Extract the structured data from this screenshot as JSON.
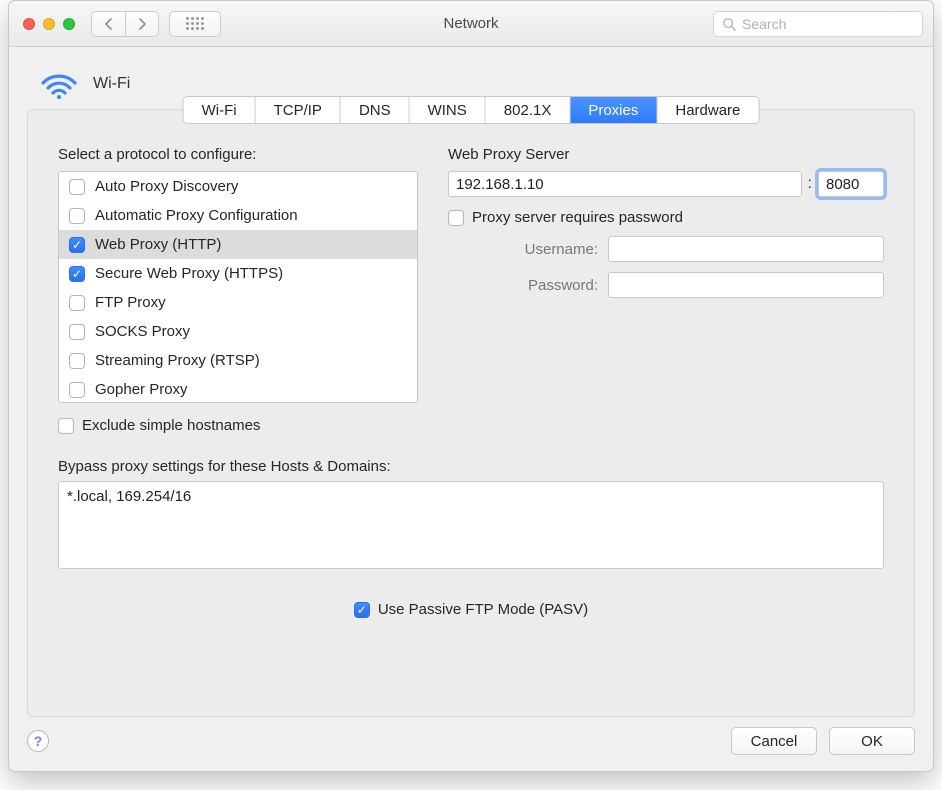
{
  "window": {
    "title": "Network"
  },
  "search": {
    "placeholder": "Search"
  },
  "header": {
    "label": "Wi-Fi"
  },
  "tabs": [
    {
      "label": "Wi-Fi",
      "active": false
    },
    {
      "label": "TCP/IP",
      "active": false
    },
    {
      "label": "DNS",
      "active": false
    },
    {
      "label": "WINS",
      "active": false
    },
    {
      "label": "802.1X",
      "active": false
    },
    {
      "label": "Proxies",
      "active": true
    },
    {
      "label": "Hardware",
      "active": false
    }
  ],
  "protocols": {
    "heading": "Select a protocol to configure:",
    "items": [
      {
        "label": "Auto Proxy Discovery",
        "checked": false,
        "selected": false
      },
      {
        "label": "Automatic Proxy Configuration",
        "checked": false,
        "selected": false
      },
      {
        "label": "Web Proxy (HTTP)",
        "checked": true,
        "selected": true
      },
      {
        "label": "Secure Web Proxy (HTTPS)",
        "checked": true,
        "selected": false
      },
      {
        "label": "FTP Proxy",
        "checked": false,
        "selected": false
      },
      {
        "label": "SOCKS Proxy",
        "checked": false,
        "selected": false
      },
      {
        "label": "Streaming Proxy (RTSP)",
        "checked": false,
        "selected": false
      },
      {
        "label": "Gopher Proxy",
        "checked": false,
        "selected": false
      }
    ]
  },
  "exclude_simple": {
    "label": "Exclude simple hostnames",
    "checked": false
  },
  "server": {
    "heading": "Web Proxy Server",
    "host": "192.168.1.10",
    "port": "8080",
    "requires_password_label": "Proxy server requires password",
    "requires_password_checked": false,
    "username_label": "Username:",
    "username_value": "",
    "password_label": "Password:",
    "password_value": ""
  },
  "bypass": {
    "heading": "Bypass proxy settings for these Hosts & Domains:",
    "value": "*.local, 169.254/16"
  },
  "pasv": {
    "label": "Use Passive FTP Mode (PASV)",
    "checked": true
  },
  "footer": {
    "cancel": "Cancel",
    "ok": "OK"
  }
}
